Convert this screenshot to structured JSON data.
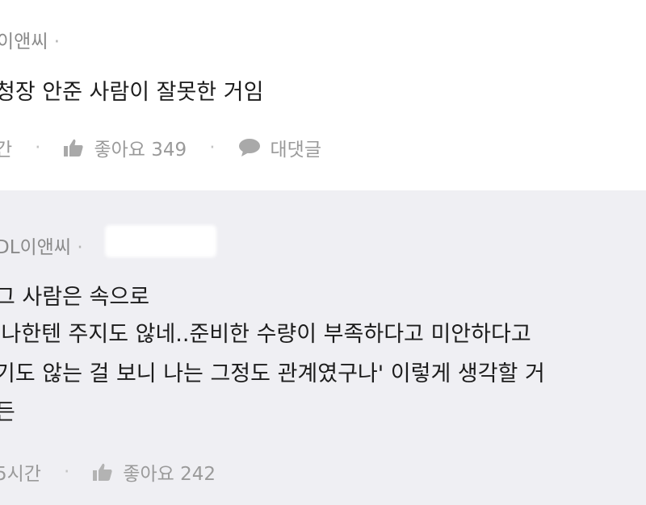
{
  "top_comment": {
    "author": "이앤씨",
    "separator": "·",
    "text": "청장 안준 사람이 잘못한 거임",
    "time": "간",
    "like_label": "좋아요 349",
    "reply_label": "대댓글"
  },
  "reply_comment": {
    "author": "DL이앤씨",
    "separator": "·",
    "lines": [
      "그 사람은 속으로",
      "'나한텐 주지도 않네..준비한 수량이 부족하다고 미안하다고",
      "기도 않는 걸 보니 나는 그정도 관계였구나' 이렇게 생각할 거",
      "든"
    ],
    "time": "5시간",
    "like_label": "좋아요 242"
  },
  "colors": {
    "top_bg": "#ffffff",
    "reply_bg": "#efeff3",
    "meta": "#9a9a9a"
  },
  "icons": [
    "thumbs-up-icon",
    "speech-bubble-icon"
  ]
}
